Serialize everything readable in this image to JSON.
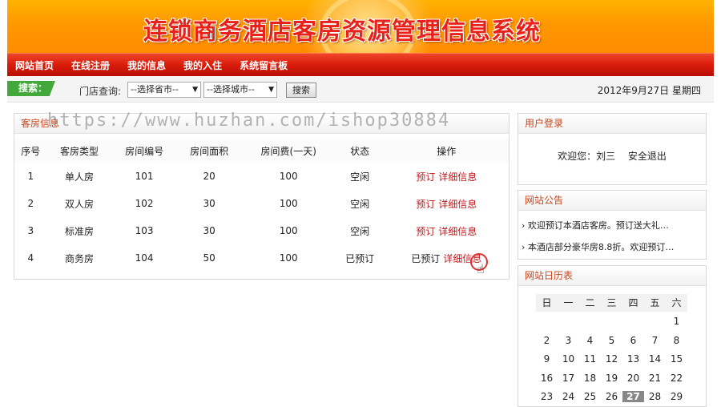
{
  "banner": {
    "title": "连锁商务酒店客房资源管理信息系统"
  },
  "nav": {
    "items": [
      "网站首页",
      "在线注册",
      "我的信息",
      "我的入住",
      "系统留言板"
    ]
  },
  "search": {
    "tag": "搜索：",
    "store_label": "门店查询:",
    "province_select": "--选择省市--",
    "city_select": "--选择城市--",
    "button": "搜索",
    "date": "2012年9月27日 星期四"
  },
  "watermark": "https://www.huzhan.com/ishop30884",
  "rooms": {
    "title": "客房信息",
    "columns": [
      "序号",
      "客房类型",
      "房间编号",
      "房间面积",
      "房间费(一天)",
      "状态",
      "操作"
    ],
    "rows": [
      {
        "no": "1",
        "type": "单人房",
        "room": "101",
        "area": "20",
        "fee": "100",
        "status": "空闲",
        "op1": "预订",
        "op2": "详细信息"
      },
      {
        "no": "2",
        "type": "双人房",
        "room": "102",
        "area": "30",
        "fee": "100",
        "status": "空闲",
        "op1": "预订",
        "op2": "详细信息"
      },
      {
        "no": "3",
        "type": "标准房",
        "room": "103",
        "area": "30",
        "fee": "100",
        "status": "空闲",
        "op1": "预订",
        "op2": "详细信息"
      },
      {
        "no": "4",
        "type": "商务房",
        "room": "104",
        "area": "50",
        "fee": "100",
        "status": "已预订",
        "op1": "已预订",
        "op2": "详细信息"
      }
    ]
  },
  "login": {
    "title": "用户登录",
    "welcome": "欢迎您：刘三",
    "logout": "安全退出"
  },
  "notice": {
    "title": "网站公告",
    "items": [
      "欢迎预订本酒店客房。预订送大礼…",
      "本酒店部分豪华房8.8折。欢迎预订…"
    ]
  },
  "calendar": {
    "title": "网站日历表",
    "weekdays": [
      "日",
      "一",
      "二",
      "三",
      "四",
      "五",
      "六"
    ],
    "weeks": [
      [
        "",
        "",
        "",
        "",
        "",
        "",
        "1"
      ],
      [
        "2",
        "3",
        "4",
        "5",
        "6",
        "7",
        "8"
      ],
      [
        "9",
        "10",
        "11",
        "12",
        "13",
        "14",
        "15"
      ],
      [
        "16",
        "17",
        "18",
        "19",
        "20",
        "21",
        "22"
      ],
      [
        "23",
        "24",
        "25",
        "26",
        "27",
        "28",
        "29"
      ]
    ],
    "today": "27"
  },
  "colors": {
    "nav_red": "#d91d0c",
    "banner_orange": "#ff9800",
    "search_green": "#43a83b",
    "link_red": "#c0161b"
  }
}
